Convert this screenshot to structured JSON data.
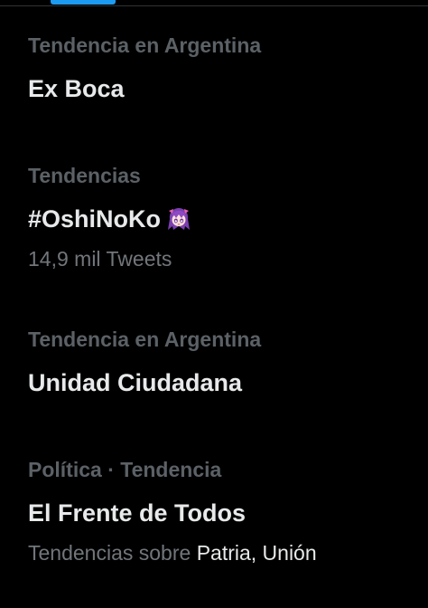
{
  "trends": [
    {
      "context": "Tendencia en Argentina",
      "title": "Ex Boca"
    },
    {
      "context": "Tendencias",
      "title": "#OshiNoKo",
      "title_icon": "anime-character-emoji-icon",
      "meta": "14,9 mil Tweets"
    },
    {
      "context": "Tendencia en Argentina",
      "title": "Unidad Ciudadana"
    },
    {
      "context": "Política · Tendencia",
      "title": "El Frente de Todos",
      "meta_prefix": "Tendencias sobre",
      "meta_related": "Patria, Unión"
    }
  ],
  "colors": {
    "background": "#000000",
    "primary_text": "#e7e9ea",
    "secondary_text": "#71767b",
    "accent": "#1d9bf0"
  }
}
